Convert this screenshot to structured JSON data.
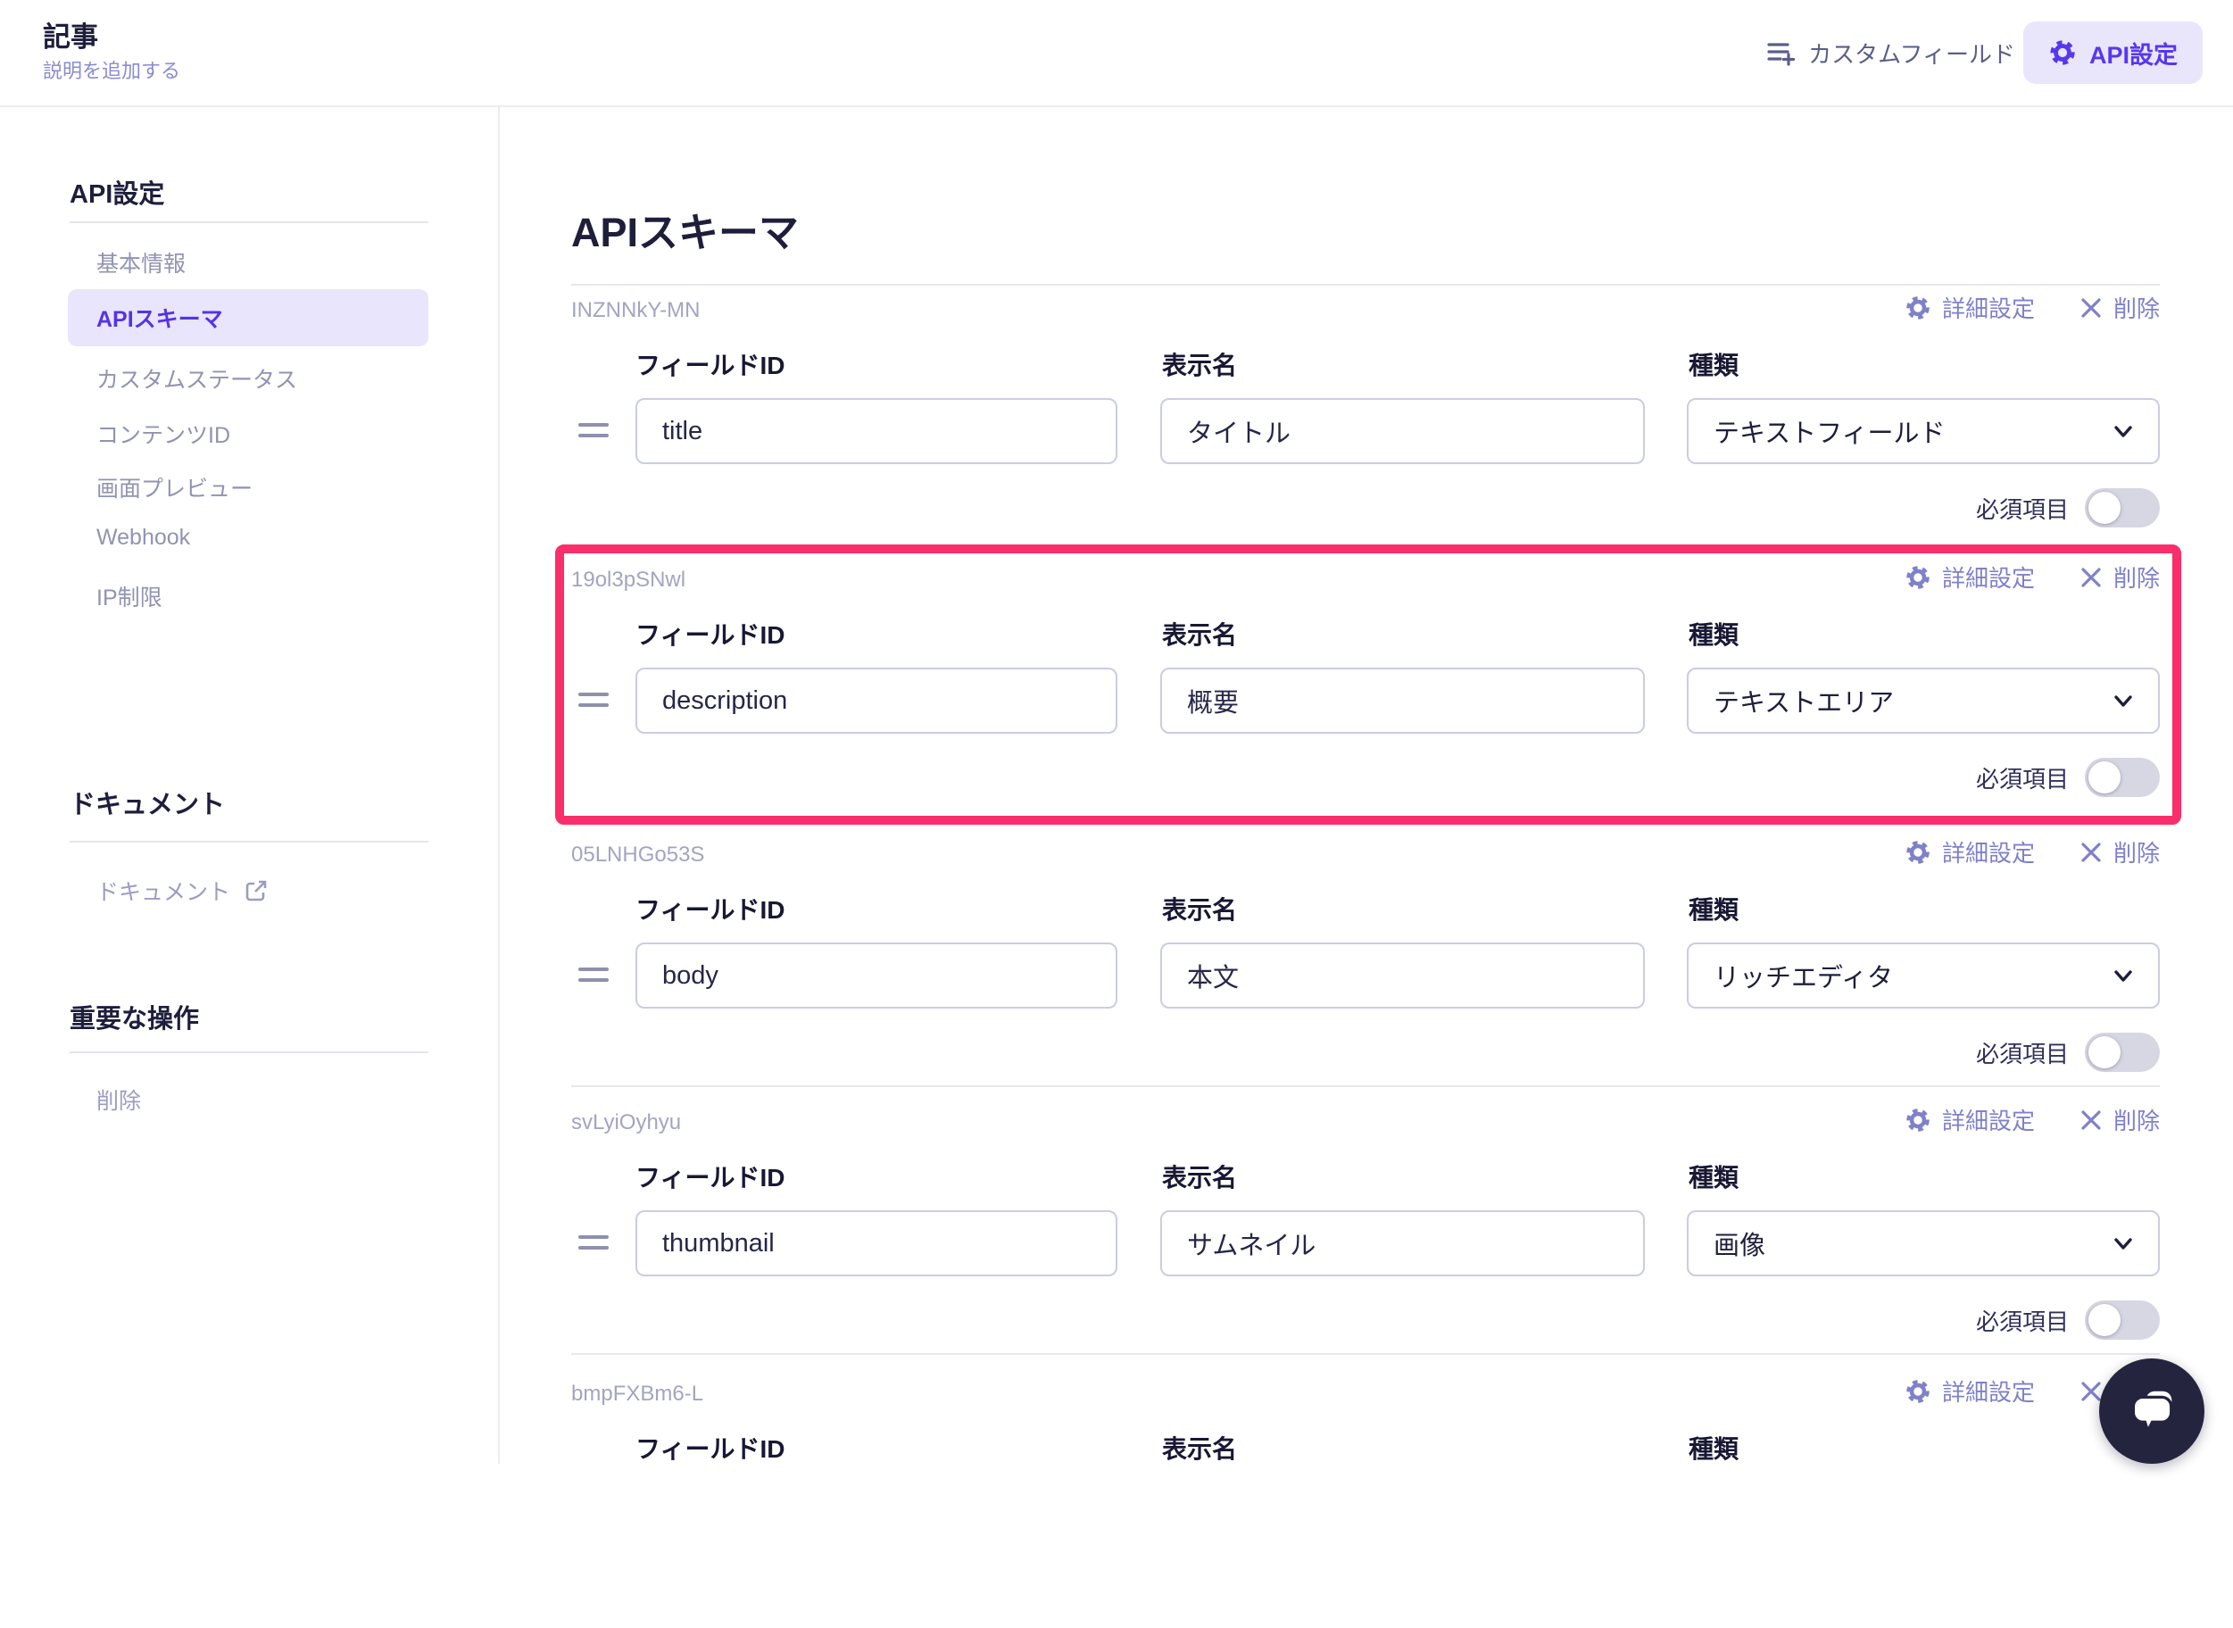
{
  "colors": {
    "accent": "#5538EE",
    "accent_bg": "#E9E6FC",
    "highlight_border": "#F92E6B",
    "action_link": "#7F81C9",
    "toggle_off_track": "#D7D7E3",
    "chat_button_bg": "#25243E"
  },
  "header": {
    "title": "記事",
    "add_description": "説明を追加する",
    "custom_fields": "カスタムフィールド",
    "api_settings": "API設定"
  },
  "sidebar": {
    "sections": [
      {
        "heading": "API設定",
        "items": [
          {
            "label": "基本情報"
          },
          {
            "label": "APIスキーマ",
            "active": true
          },
          {
            "label": "カスタムステータス"
          },
          {
            "label": "コンテンツID"
          },
          {
            "label": "画面プレビュー"
          },
          {
            "label": "Webhook"
          },
          {
            "label": "IP制限"
          }
        ]
      },
      {
        "heading": "ドキュメント",
        "items": [
          {
            "label": "ドキュメント",
            "external": true
          }
        ]
      },
      {
        "heading": "重要な操作",
        "items": [
          {
            "label": "削除"
          }
        ]
      }
    ]
  },
  "main": {
    "heading": "APIスキーマ",
    "labels": {
      "field_id": "フィールドID",
      "display_name": "表示名",
      "kind": "種類",
      "required": "必須項目"
    },
    "actions": {
      "advanced": "詳細設定",
      "delete": "削除"
    },
    "rows": [
      {
        "id": "INZNNkY-MN",
        "field_id": "title",
        "display_name": "タイトル",
        "kind": "テキストフィールド",
        "required": false
      },
      {
        "id": "19ol3pSNwl",
        "field_id": "description",
        "display_name": "概要",
        "kind": "テキストエリア",
        "required": false,
        "highlighted": true
      },
      {
        "id": "05LNHGo53S",
        "field_id": "body",
        "display_name": "本文",
        "kind": "リッチエディタ",
        "required": false
      },
      {
        "id": "svLyiOyhyu",
        "field_id": "thumbnail",
        "display_name": "サムネイル",
        "kind": "画像",
        "required": false
      },
      {
        "id": "bmpFXBm6-L",
        "partial": true
      }
    ]
  }
}
